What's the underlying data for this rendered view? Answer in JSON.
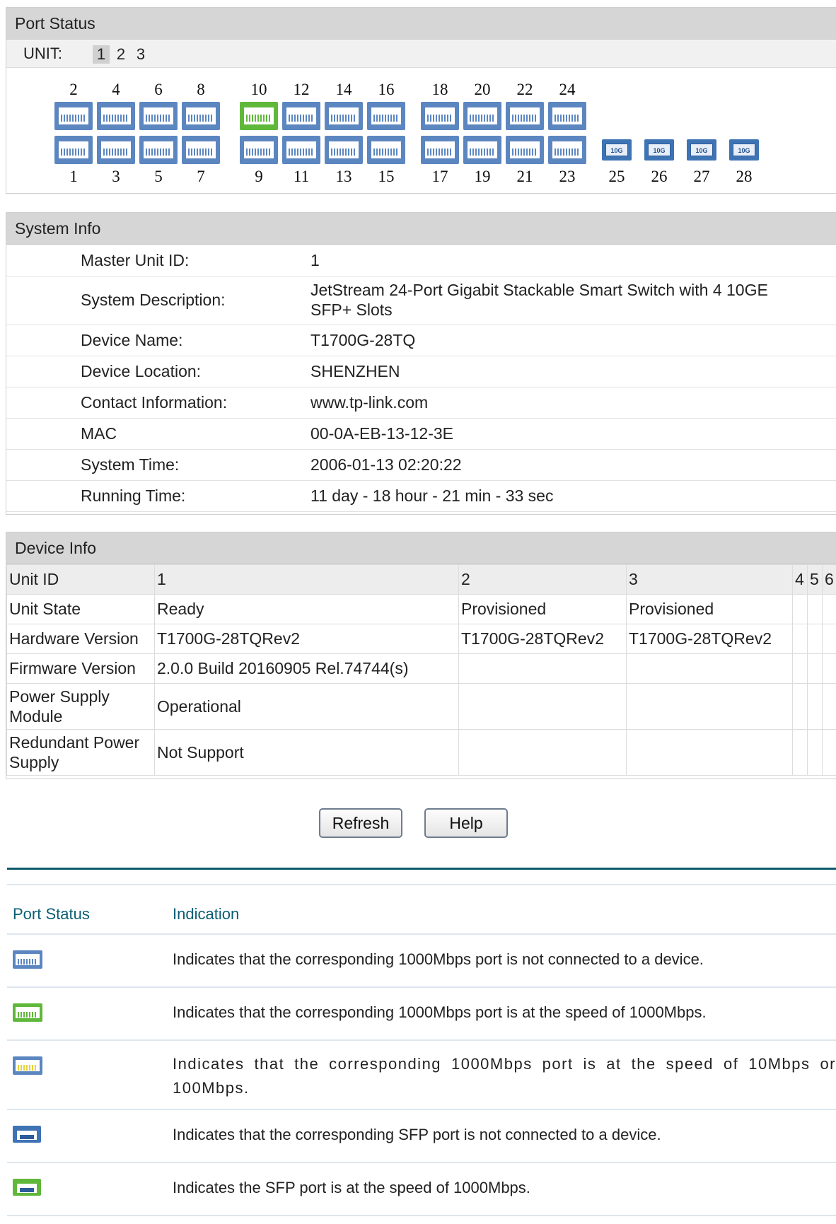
{
  "port_status": {
    "title": "Port Status",
    "unit_label": "UNIT:",
    "units": [
      "1",
      "2",
      "3"
    ],
    "active_unit": "1",
    "top_ports": [
      "2",
      "4",
      "6",
      "8",
      "10",
      "12",
      "14",
      "16",
      "18",
      "20",
      "22",
      "24"
    ],
    "bottom_ports": [
      "1",
      "3",
      "5",
      "7",
      "9",
      "11",
      "13",
      "15",
      "17",
      "19",
      "21",
      "23"
    ],
    "sfp_ports": [
      "25",
      "26",
      "27",
      "28"
    ],
    "sfp_icon_text": "10G",
    "connected_ports": [
      "10"
    ]
  },
  "system_info": {
    "title": "System Info",
    "rows": [
      {
        "label": "Master Unit ID:",
        "value": "1"
      },
      {
        "label": "System Description:",
        "value": "JetStream 24-Port Gigabit Stackable Smart Switch with 4 10GE SFP+ Slots"
      },
      {
        "label": "Device Name:",
        "value": "T1700G-28TQ"
      },
      {
        "label": "Device Location:",
        "value": "SHENZHEN"
      },
      {
        "label": "Contact Information:",
        "value": "www.tp-link.com"
      },
      {
        "label": "MAC",
        "value": "00-0A-EB-13-12-3E"
      },
      {
        "label": "System Time:",
        "value": "2006-01-13 02:20:22"
      },
      {
        "label": "Running Time:",
        "value": "11 day - 18 hour - 21 min - 33 sec"
      }
    ]
  },
  "device_info": {
    "title": "Device Info",
    "header": [
      "Unit ID",
      "1",
      "2",
      "3",
      "4",
      "5",
      "6"
    ],
    "rows": [
      [
        "Unit State",
        "Ready",
        "Provisioned",
        "Provisioned",
        "",
        "",
        ""
      ],
      [
        "Hardware Version",
        "T1700G-28TQRev2",
        "T1700G-28TQRev2",
        "T1700G-28TQRev2",
        "",
        "",
        ""
      ],
      [
        "Firmware Version",
        "2.0.0 Build 20160905 Rel.74744(s)",
        "",
        "",
        "",
        "",
        ""
      ],
      [
        "Power Supply Module",
        "Operational",
        "",
        "",
        "",
        "",
        ""
      ],
      [
        "Redundant Power Supply",
        "Not Support",
        "",
        "",
        "",
        "",
        ""
      ]
    ]
  },
  "buttons": {
    "refresh": "Refresh",
    "help": "Help"
  },
  "legend": {
    "col_status": "Port Status",
    "col_indication": "Indication",
    "rows": [
      {
        "icon": "rj45-port-disconnected-icon",
        "color": "#5c86c0",
        "text": "Indicates that the corresponding 1000Mbps port is not connected to a device."
      },
      {
        "icon": "rj45-port-1000mbps-icon",
        "color": "#5fb83a",
        "text": "Indicates that the corresponding 1000Mbps port is at the speed of 1000Mbps."
      },
      {
        "icon": "rj45-port-10-100mbps-icon",
        "color": "#e6d23a",
        "text": "Indicates that the corresponding 1000Mbps port is at the speed of 10Mbps or 100Mbps."
      },
      {
        "icon": "sfp-port-disconnected-icon",
        "color": "#3e73b4",
        "text": "Indicates that the corresponding SFP port is not connected to a device."
      },
      {
        "icon": "sfp-port-1000mbps-icon",
        "color": "#5fb83a",
        "text": "Indicates the SFP port is at the speed of 1000Mbps."
      }
    ]
  }
}
